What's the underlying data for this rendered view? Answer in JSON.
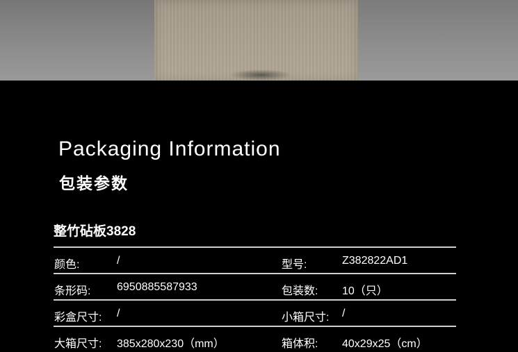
{
  "header_image": {
    "description_icon": "product-photo-cutting-board"
  },
  "heading": {
    "english": "Packaging Information",
    "chinese": "包装参数"
  },
  "product": {
    "name": "整竹砧板3828"
  },
  "specs": [
    {
      "label1": "颜色:",
      "value1": "/",
      "label2": "型号:",
      "value2": "Z382822AD1"
    },
    {
      "label1": "条形码:",
      "value1": "6950885587933",
      "label2": "包装数:",
      "value2": "10（只）"
    },
    {
      "label1": "彩盒尺寸:",
      "value1": "/",
      "label2": "小箱尺寸:",
      "value2": "/"
    },
    {
      "label1": "大箱尺寸:",
      "value1": "385x280x230（mm）",
      "label2": "箱体积:",
      "value2": "40x29x25（cm）"
    }
  ]
}
